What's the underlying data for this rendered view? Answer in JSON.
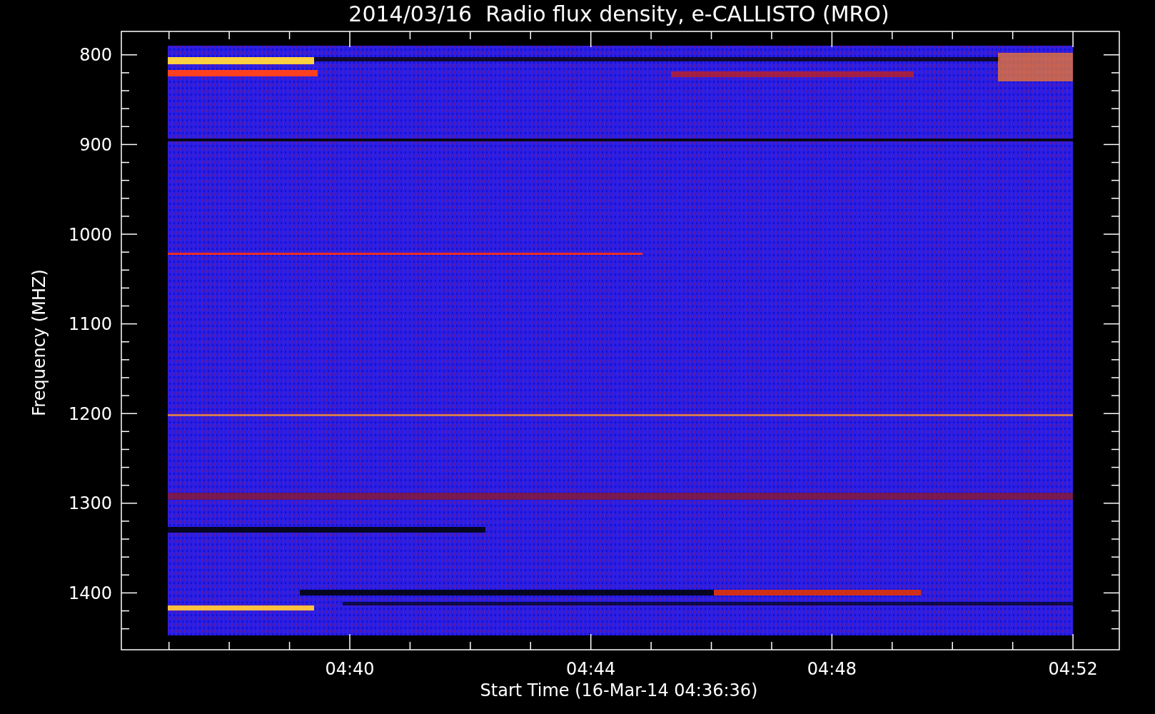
{
  "title": "2014/03/16  Radio flux density, e-CALLISTO (MRO)",
  "plot": {
    "ylabel": "Frequency (MHZ)",
    "xlabel": "Start Time (16-Mar-14 04:36:36)",
    "yticks": [
      "800",
      "900",
      "1000",
      "1100",
      "1200",
      "1300",
      "1400"
    ],
    "xticks": [
      "04:40",
      "04:44",
      "04:48",
      "04:52"
    ]
  }
}
